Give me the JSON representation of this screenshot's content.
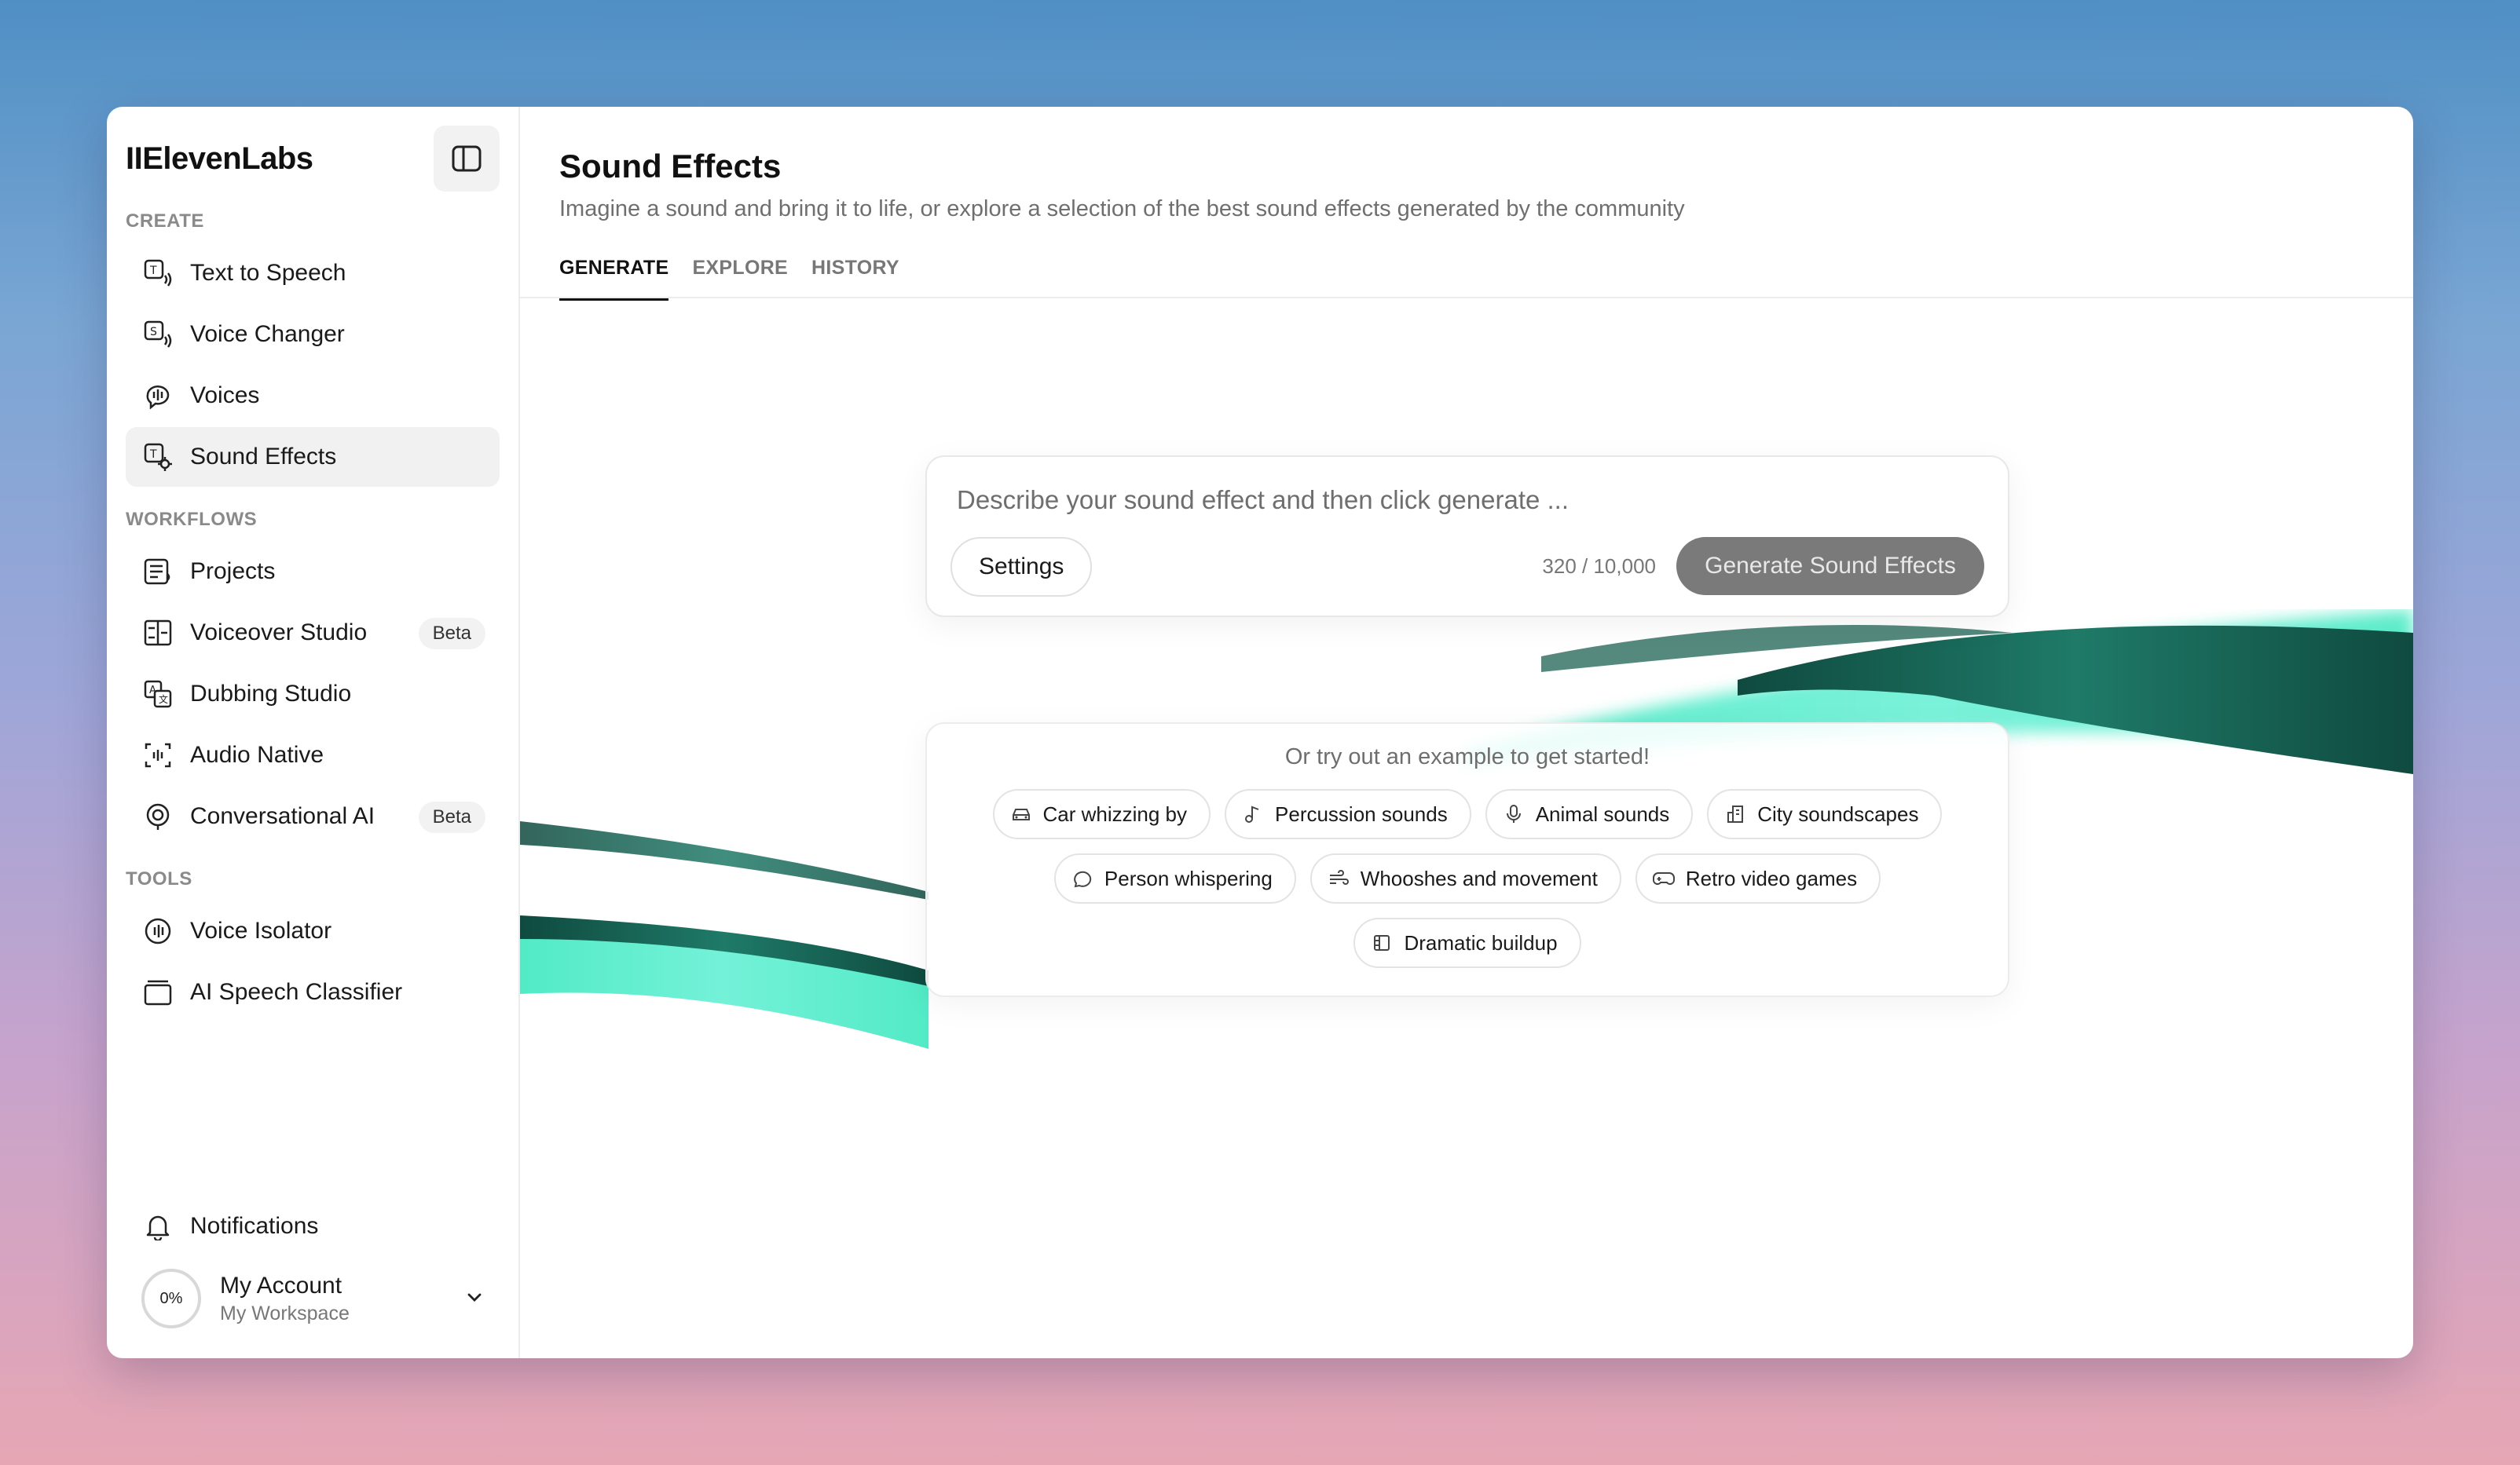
{
  "brand": "IIElevenLabs",
  "sidebar": {
    "sections": [
      {
        "label": "CREATE"
      },
      {
        "label": "WORKFLOWS"
      },
      {
        "label": "TOOLS"
      }
    ],
    "create_items": [
      {
        "label": "Text to Speech",
        "icon": "text-to-speech-icon"
      },
      {
        "label": "Voice Changer",
        "icon": "voice-changer-icon"
      },
      {
        "label": "Voices",
        "icon": "voices-icon"
      },
      {
        "label": "Sound Effects",
        "icon": "sound-effects-icon",
        "active": true
      }
    ],
    "workflow_items": [
      {
        "label": "Projects",
        "icon": "projects-icon"
      },
      {
        "label": "Voiceover Studio",
        "icon": "voiceover-studio-icon",
        "badge": "Beta"
      },
      {
        "label": "Dubbing Studio",
        "icon": "dubbing-studio-icon"
      },
      {
        "label": "Audio Native",
        "icon": "audio-native-icon"
      },
      {
        "label": "Conversational AI",
        "icon": "conversational-ai-icon",
        "badge": "Beta"
      }
    ],
    "tool_items": [
      {
        "label": "Voice Isolator",
        "icon": "voice-isolator-icon"
      },
      {
        "label": "AI Speech Classifier",
        "icon": "ai-speech-classifier-icon"
      }
    ],
    "notifications": "Notifications",
    "account": {
      "progress": "0%",
      "name": "My Account",
      "workspace": "My Workspace"
    }
  },
  "main": {
    "title": "Sound Effects",
    "subtitle": "Imagine a sound and bring it to life, or explore a selection of the best sound effects generated by the community",
    "tabs": [
      {
        "label": "GENERATE",
        "active": true
      },
      {
        "label": "EXPLORE"
      },
      {
        "label": "HISTORY"
      }
    ],
    "prompt": {
      "placeholder": "Describe your sound effect and then click generate ...",
      "settings_label": "Settings",
      "char_count": "320 / 10,000",
      "generate_label": "Generate Sound Effects"
    },
    "examples": {
      "title": "Or try out an example to get started!",
      "chips": [
        {
          "label": "Car whizzing by",
          "icon": "car-icon"
        },
        {
          "label": "Percussion sounds",
          "icon": "music-note-icon"
        },
        {
          "label": "Animal sounds",
          "icon": "microphone-icon"
        },
        {
          "label": "City soundscapes",
          "icon": "building-icon"
        },
        {
          "label": "Person whispering",
          "icon": "chat-bubble-icon"
        },
        {
          "label": "Whooshes and movement",
          "icon": "wind-icon"
        },
        {
          "label": "Retro video games",
          "icon": "gamepad-icon"
        },
        {
          "label": "Dramatic buildup",
          "icon": "film-icon"
        }
      ]
    }
  },
  "colors": {
    "accent_wave": "#3fe8c0",
    "dark_wave": "#0f4a3f",
    "generate_button": "#7a7a7a"
  }
}
